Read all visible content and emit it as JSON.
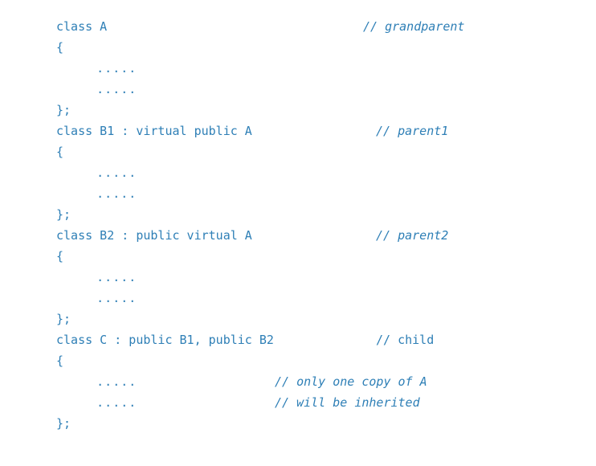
{
  "code": {
    "lines": [
      {
        "text": "class A",
        "comment": "// grandparent"
      },
      {
        "text": "{"
      },
      {
        "text": "     ....."
      },
      {
        "text": "     ....."
      },
      {
        "text": "};"
      },
      {
        "text": "class B1 : virtual public A",
        "comment": "// parent1"
      },
      {
        "text": "{"
      },
      {
        "text": "     ....."
      },
      {
        "text": "     ....."
      },
      {
        "text": "};"
      },
      {
        "text": "class B2 : public virtual A",
        "comment": "// parent2"
      },
      {
        "text": "{"
      },
      {
        "text": "     ....."
      },
      {
        "text": "     ....."
      },
      {
        "text": "};"
      },
      {
        "text": "class C : public B1, public B2",
        "comment": "// child"
      },
      {
        "text": "{"
      },
      {
        "text": "     .....",
        "comment": "// only one copy of A"
      },
      {
        "text": "     .....",
        "comment": "// will be inherited"
      },
      {
        "text": "};"
      }
    ]
  }
}
